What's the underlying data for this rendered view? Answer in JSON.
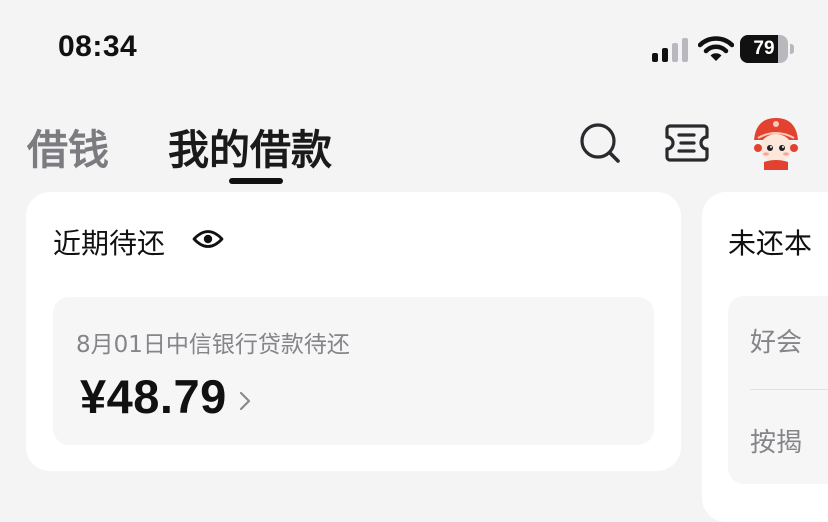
{
  "status_bar": {
    "time": "08:34",
    "battery_level": "79",
    "battery_fraction": 0.79
  },
  "nav": {
    "tabs": [
      {
        "label": "借钱",
        "active": false
      },
      {
        "label": "我的借款",
        "active": true
      }
    ],
    "icons": [
      "search-icon",
      "coupon-icon",
      "avatar"
    ]
  },
  "recent_due": {
    "title": "近期待还",
    "description": "8月01日中信银行贷款待还",
    "amount": "¥48.79"
  },
  "side_card": {
    "title": "未还本",
    "rows": [
      "好会",
      "按揭"
    ]
  },
  "colors": {
    "background": "#f4f4f5",
    "card": "#ffffff",
    "active_tab": "#1a1a1a",
    "inactive_tab": "#7c7c80",
    "muted_text": "#858589",
    "avatar_red": "#e2422f"
  }
}
